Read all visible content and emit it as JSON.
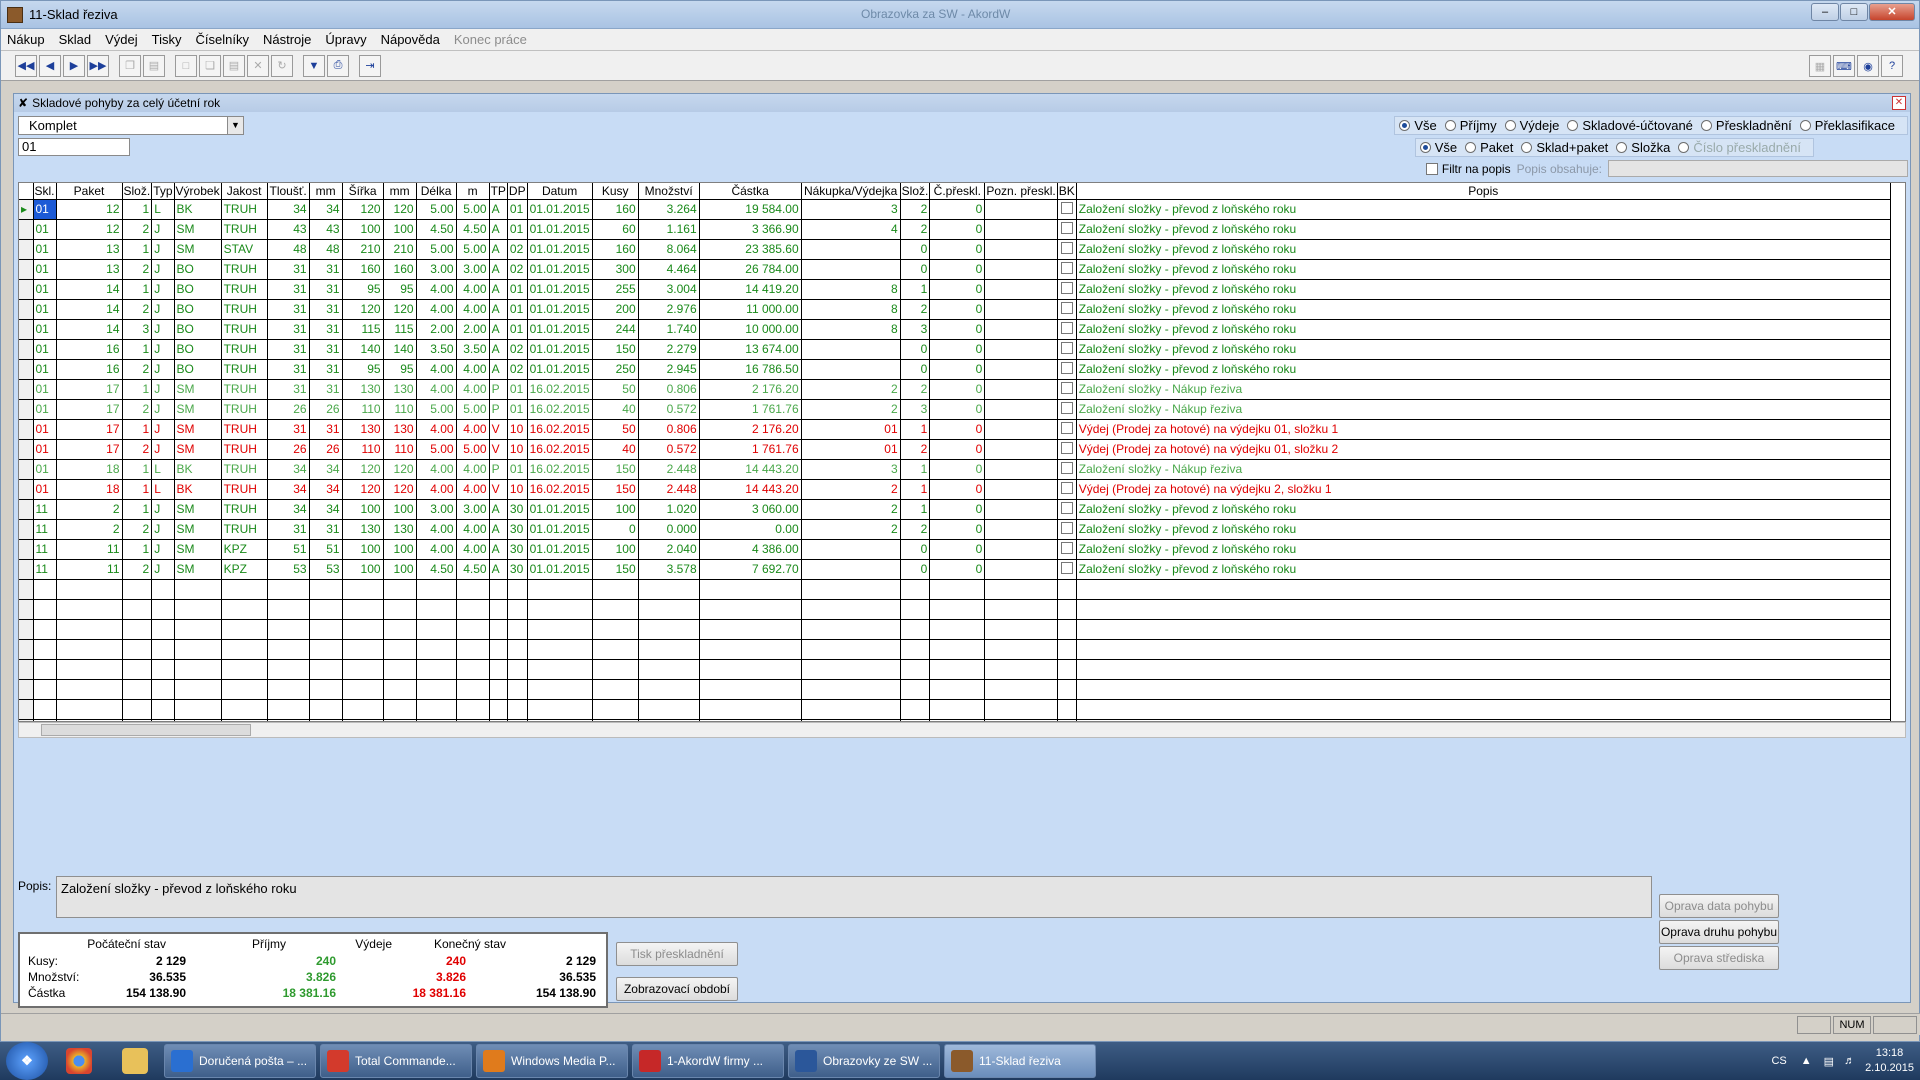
{
  "window": {
    "title": "11-Sklad řeziva",
    "faded_title": "Obrazovka za SW - AkordW"
  },
  "menu": [
    {
      "label": "Nákup",
      "enabled": true
    },
    {
      "label": "Sklad",
      "enabled": true
    },
    {
      "label": "Výdej",
      "enabled": true
    },
    {
      "label": "Tisky",
      "enabled": true
    },
    {
      "label": "Číselníky",
      "enabled": true
    },
    {
      "label": "Nástroje",
      "enabled": true
    },
    {
      "label": "Úpravy",
      "enabled": true
    },
    {
      "label": "Nápověda",
      "enabled": true
    },
    {
      "label": "Konec práce",
      "enabled": false
    }
  ],
  "child": {
    "title": "Skladové pohyby za celý účetní rok"
  },
  "filters": {
    "combo_value": "Komplet",
    "text_value": "01",
    "group1": [
      {
        "label": "Vše",
        "on": true
      },
      {
        "label": "Příjmy",
        "on": false
      },
      {
        "label": "Výdeje",
        "on": false
      },
      {
        "label": "Skladové-účtované",
        "on": false
      },
      {
        "label": "Přeskladnění",
        "on": false
      },
      {
        "label": "Překlasifikace",
        "on": false
      }
    ],
    "group2": [
      {
        "label": "Vše",
        "on": true,
        "dis": false
      },
      {
        "label": "Paket",
        "on": false,
        "dis": false
      },
      {
        "label": "Sklad+paket",
        "on": false,
        "dis": false
      },
      {
        "label": "Složka",
        "on": false,
        "dis": false
      },
      {
        "label": "Číslo přeskladnění",
        "on": false,
        "dis": true
      }
    ],
    "filtr_label": "Filtr na popis",
    "popis_obsahuje_label": "Popis obsahuje:"
  },
  "grid": {
    "columns": [
      "",
      "Skl.",
      "Paket",
      "Slož.",
      "Typ",
      "Výrobek",
      "Jakost",
      "Tloušť.",
      "mm",
      "Šířka",
      "mm",
      "Délka",
      "m",
      "TP",
      "DP",
      "Datum",
      "Kusy",
      "Množství",
      "Částka",
      "Nákupka/Výdejka",
      "Slož.",
      "Č.přeskl.",
      "Pozn. přeskl.",
      "BK",
      "Popis"
    ],
    "rows": [
      {
        "style": "green",
        "cells": [
          "01",
          "12",
          "1",
          "L",
          "BK",
          "TRUH",
          "34",
          "34",
          "120",
          "120",
          "5.00",
          "5.00",
          "A",
          "01",
          "01.01.2015",
          "160",
          "3.264",
          "19 584.00",
          "3",
          "2",
          "0",
          "",
          "",
          "Založení složky - převod z loňského roku"
        ]
      },
      {
        "style": "green",
        "cells": [
          "01",
          "12",
          "2",
          "J",
          "SM",
          "TRUH",
          "43",
          "43",
          "100",
          "100",
          "4.50",
          "4.50",
          "A",
          "01",
          "01.01.2015",
          "60",
          "1.161",
          "3 366.90",
          "4",
          "2",
          "0",
          "",
          "",
          "Založení složky - převod z loňského roku"
        ]
      },
      {
        "style": "green",
        "cells": [
          "01",
          "13",
          "1",
          "J",
          "SM",
          "STAV",
          "48",
          "48",
          "210",
          "210",
          "5.00",
          "5.00",
          "A",
          "02",
          "01.01.2015",
          "160",
          "8.064",
          "23 385.60",
          "",
          "0",
          "0",
          "",
          "",
          "Založení složky - převod z loňského roku"
        ]
      },
      {
        "style": "green",
        "cells": [
          "01",
          "13",
          "2",
          "J",
          "BO",
          "TRUH",
          "31",
          "31",
          "160",
          "160",
          "3.00",
          "3.00",
          "A",
          "02",
          "01.01.2015",
          "300",
          "4.464",
          "26 784.00",
          "",
          "0",
          "0",
          "",
          "",
          "Založení složky - převod z loňského roku"
        ]
      },
      {
        "style": "green",
        "cells": [
          "01",
          "14",
          "1",
          "J",
          "BO",
          "TRUH",
          "31",
          "31",
          "95",
          "95",
          "4.00",
          "4.00",
          "A",
          "01",
          "01.01.2015",
          "255",
          "3.004",
          "14 419.20",
          "8",
          "1",
          "0",
          "",
          "",
          "Založení složky - převod z loňského roku"
        ]
      },
      {
        "style": "green",
        "cells": [
          "01",
          "14",
          "2",
          "J",
          "BO",
          "TRUH",
          "31",
          "31",
          "120",
          "120",
          "4.00",
          "4.00",
          "A",
          "01",
          "01.01.2015",
          "200",
          "2.976",
          "11 000.00",
          "8",
          "2",
          "0",
          "",
          "",
          "Založení složky - převod z loňského roku"
        ]
      },
      {
        "style": "green",
        "cells": [
          "01",
          "14",
          "3",
          "J",
          "BO",
          "TRUH",
          "31",
          "31",
          "115",
          "115",
          "2.00",
          "2.00",
          "A",
          "01",
          "01.01.2015",
          "244",
          "1.740",
          "10 000.00",
          "8",
          "3",
          "0",
          "",
          "",
          "Založení složky - převod z loňského roku"
        ]
      },
      {
        "style": "green",
        "cells": [
          "01",
          "16",
          "1",
          "J",
          "BO",
          "TRUH",
          "31",
          "31",
          "140",
          "140",
          "3.50",
          "3.50",
          "A",
          "02",
          "01.01.2015",
          "150",
          "2.279",
          "13 674.00",
          "",
          "0",
          "0",
          "",
          "",
          "Založení složky - převod z loňského roku"
        ]
      },
      {
        "style": "green",
        "cells": [
          "01",
          "16",
          "2",
          "J",
          "BO",
          "TRUH",
          "31",
          "31",
          "95",
          "95",
          "4.00",
          "4.00",
          "A",
          "02",
          "01.01.2015",
          "250",
          "2.945",
          "16 786.50",
          "",
          "0",
          "0",
          "",
          "",
          "Založení složky - převod z loňského roku"
        ]
      },
      {
        "style": "lgreen",
        "cells": [
          "01",
          "17",
          "1",
          "J",
          "SM",
          "TRUH",
          "31",
          "31",
          "130",
          "130",
          "4.00",
          "4.00",
          "P",
          "01",
          "16.02.2015",
          "50",
          "0.806",
          "2 176.20",
          "2",
          "2",
          "0",
          "",
          "",
          "Založení složky - Nákup řeziva"
        ]
      },
      {
        "style": "lgreen",
        "cells": [
          "01",
          "17",
          "2",
          "J",
          "SM",
          "TRUH",
          "26",
          "26",
          "110",
          "110",
          "5.00",
          "5.00",
          "P",
          "01",
          "16.02.2015",
          "40",
          "0.572",
          "1 761.76",
          "2",
          "3",
          "0",
          "",
          "",
          "Založení složky - Nákup řeziva"
        ]
      },
      {
        "style": "red",
        "cells": [
          "01",
          "17",
          "1",
          "J",
          "SM",
          "TRUH",
          "31",
          "31",
          "130",
          "130",
          "4.00",
          "4.00",
          "V",
          "10",
          "16.02.2015",
          "50",
          "0.806",
          "2 176.20",
          "01",
          "1",
          "0",
          "",
          "",
          "Výdej (Prodej za hotové) na výdejku 01, složku 1"
        ]
      },
      {
        "style": "red",
        "cells": [
          "01",
          "17",
          "2",
          "J",
          "SM",
          "TRUH",
          "26",
          "26",
          "110",
          "110",
          "5.00",
          "5.00",
          "V",
          "10",
          "16.02.2015",
          "40",
          "0.572",
          "1 761.76",
          "01",
          "2",
          "0",
          "",
          "",
          "Výdej (Prodej za hotové) na výdejku 01, složku 2"
        ]
      },
      {
        "style": "lgreen",
        "cells": [
          "01",
          "18",
          "1",
          "L",
          "BK",
          "TRUH",
          "34",
          "34",
          "120",
          "120",
          "4.00",
          "4.00",
          "P",
          "01",
          "16.02.2015",
          "150",
          "2.448",
          "14 443.20",
          "3",
          "1",
          "0",
          "",
          "",
          "Založení složky - Nákup řeziva"
        ]
      },
      {
        "style": "red",
        "cells": [
          "01",
          "18",
          "1",
          "L",
          "BK",
          "TRUH",
          "34",
          "34",
          "120",
          "120",
          "4.00",
          "4.00",
          "V",
          "10",
          "16.02.2015",
          "150",
          "2.448",
          "14 443.20",
          "2",
          "1",
          "0",
          "",
          "",
          "Výdej (Prodej za hotové) na výdejku 2, složku 1"
        ]
      },
      {
        "style": "green",
        "cells": [
          "11",
          "2",
          "1",
          "J",
          "SM",
          "TRUH",
          "34",
          "34",
          "100",
          "100",
          "3.00",
          "3.00",
          "A",
          "30",
          "01.01.2015",
          "100",
          "1.020",
          "3 060.00",
          "2",
          "1",
          "0",
          "",
          "",
          "Založení složky - převod z loňského roku"
        ]
      },
      {
        "style": "green",
        "cells": [
          "11",
          "2",
          "2",
          "J",
          "SM",
          "TRUH",
          "31",
          "31",
          "130",
          "130",
          "4.00",
          "4.00",
          "A",
          "30",
          "01.01.2015",
          "0",
          "0.000",
          "0.00",
          "2",
          "2",
          "0",
          "",
          "",
          "Založení složky - převod z loňského roku"
        ]
      },
      {
        "style": "green",
        "cells": [
          "11",
          "11",
          "1",
          "J",
          "SM",
          "KPZ",
          "51",
          "51",
          "100",
          "100",
          "4.00",
          "4.00",
          "A",
          "30",
          "01.01.2015",
          "100",
          "2.040",
          "4 386.00",
          "",
          "0",
          "0",
          "",
          "",
          "Založení složky - převod z loňského roku"
        ]
      },
      {
        "style": "green",
        "cells": [
          "11",
          "11",
          "2",
          "J",
          "SM",
          "KPZ",
          "53",
          "53",
          "100",
          "100",
          "4.50",
          "4.50",
          "A",
          "30",
          "01.01.2015",
          "150",
          "3.578",
          "7 692.70",
          "",
          "0",
          "0",
          "",
          "",
          "Založení složky - převod z loňského roku"
        ]
      }
    ]
  },
  "popis": {
    "label": "Popis:",
    "value": "Založení složky - převod z loňského roku"
  },
  "summary": {
    "headers": [
      "Počáteční stav",
      "Příjmy",
      "Výdeje",
      "Konečný stav"
    ],
    "rows": [
      {
        "label": "Kusy:",
        "values": [
          "2 129",
          "240",
          "240",
          "2 129"
        ]
      },
      {
        "label": "Množství:",
        "values": [
          "36.535",
          "3.826",
          "3.826",
          "36.535"
        ]
      },
      {
        "label": "Částka",
        "values": [
          "154 138.90",
          "18 381.16",
          "18 381.16",
          "154 138.90"
        ]
      }
    ],
    "colors": {
      "prijmy": "#2e9a2e",
      "vydeje": "#e00000"
    }
  },
  "buttons": {
    "tisk": "Tisk přeskladnění",
    "obdobi": "Zobrazovací období",
    "oprava_data": "Oprava data pohybu",
    "oprava_druhu": "Oprava druhu pohybu",
    "oprava_strediska": "Oprava střediska"
  },
  "status": {
    "num": "NUM"
  },
  "taskbar": {
    "items": [
      "Doručená pošta – ...",
      "Total Commande...",
      "Windows Media P...",
      "1-AkordW firmy ...",
      "Obrazovky ze SW ...",
      "11-Sklad řeziva"
    ],
    "lang": "CS",
    "time": "13:18",
    "date": "2.10.2015"
  }
}
